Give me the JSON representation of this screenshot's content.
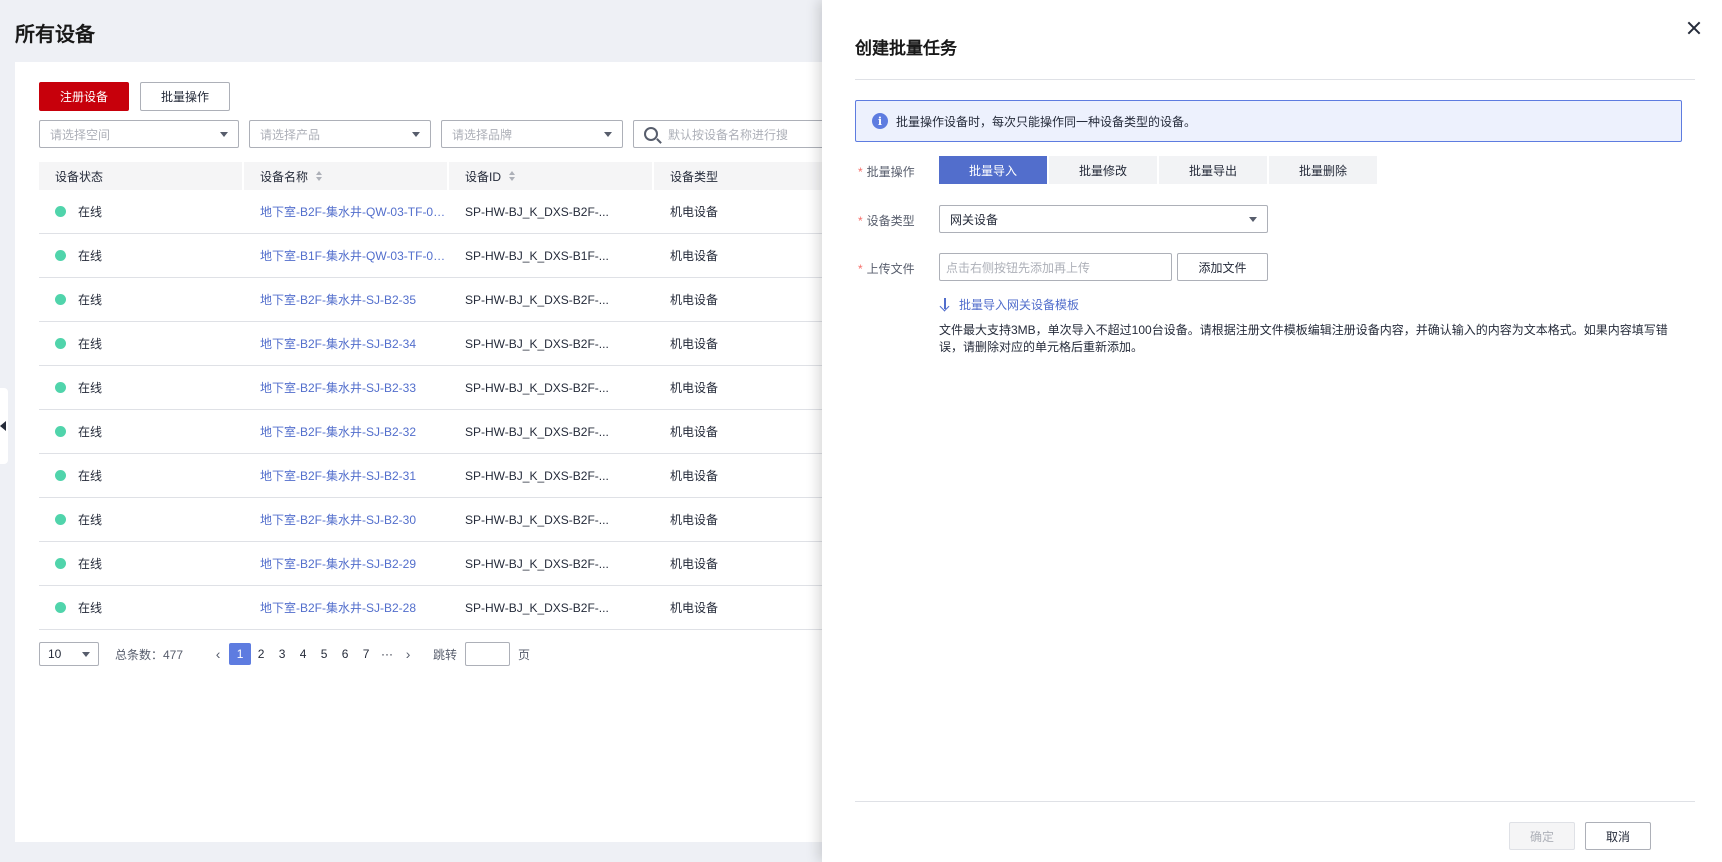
{
  "page": {
    "title": "所有设备"
  },
  "toolbar": {
    "register_label": "注册设备",
    "batch_label": "批量操作"
  },
  "filters": {
    "space_placeholder": "请选择空间",
    "product_placeholder": "请选择产品",
    "brand_placeholder": "请选择品牌",
    "search_placeholder": "默认按设备名称进行搜"
  },
  "table": {
    "headers": [
      "设备状态",
      "设备名称",
      "设备ID",
      "设备类型"
    ],
    "rows": [
      {
        "status": "在线",
        "name": "地下室-B2F-集水井-QW-03-TF-03...",
        "id": "SP-HW-BJ_K_DXS-B2F-...",
        "type": "机电设备"
      },
      {
        "status": "在线",
        "name": "地下室-B1F-集水井-QW-03-TF-04...",
        "id": "SP-HW-BJ_K_DXS-B1F-...",
        "type": "机电设备"
      },
      {
        "status": "在线",
        "name": "地下室-B2F-集水井-SJ-B2-35",
        "id": "SP-HW-BJ_K_DXS-B2F-...",
        "type": "机电设备"
      },
      {
        "status": "在线",
        "name": "地下室-B2F-集水井-SJ-B2-34",
        "id": "SP-HW-BJ_K_DXS-B2F-...",
        "type": "机电设备"
      },
      {
        "status": "在线",
        "name": "地下室-B2F-集水井-SJ-B2-33",
        "id": "SP-HW-BJ_K_DXS-B2F-...",
        "type": "机电设备"
      },
      {
        "status": "在线",
        "name": "地下室-B2F-集水井-SJ-B2-32",
        "id": "SP-HW-BJ_K_DXS-B2F-...",
        "type": "机电设备"
      },
      {
        "status": "在线",
        "name": "地下室-B2F-集水井-SJ-B2-31",
        "id": "SP-HW-BJ_K_DXS-B2F-...",
        "type": "机电设备"
      },
      {
        "status": "在线",
        "name": "地下室-B2F-集水井-SJ-B2-30",
        "id": "SP-HW-BJ_K_DXS-B2F-...",
        "type": "机电设备"
      },
      {
        "status": "在线",
        "name": "地下室-B2F-集水井-SJ-B2-29",
        "id": "SP-HW-BJ_K_DXS-B2F-...",
        "type": "机电设备"
      },
      {
        "status": "在线",
        "name": "地下室-B2F-集水井-SJ-B2-28",
        "id": "SP-HW-BJ_K_DXS-B2F-...",
        "type": "机电设备"
      }
    ]
  },
  "pager": {
    "page_size": "10",
    "total": "总条数：477",
    "pages": [
      "1",
      "2",
      "3",
      "4",
      "5",
      "6",
      "7",
      "···"
    ],
    "current": "1",
    "jump_label": "跳转",
    "page_suffix": "页"
  },
  "drawer": {
    "title": "创建批量任务",
    "notice": "批量操作设备时，每次只能操作同一种设备类型的设备。",
    "op_label": "批量操作",
    "ops": [
      "批量导入",
      "批量修改",
      "批量导出",
      "批量删除"
    ],
    "active_op": "批量导入",
    "type_label": "设备类型",
    "type_value": "网关设备",
    "upload_label": "上传文件",
    "upload_placeholder": "点击右侧按钮先添加再上传",
    "add_file_label": "添加文件",
    "template_link": "批量导入网关设备模板",
    "help_text": "文件最大支持3MB，单次导入不超过100台设备。请根据注册文件模板编辑注册设备内容，并确认输入的内容为文本格式。如果内容填写错误，请删除对应的单元格后重新添加。",
    "confirm_label": "确定",
    "cancel_label": "取消",
    "required_mark": "*"
  },
  "colors": {
    "primary": "#c7000b",
    "accent": "#526ecc",
    "online": "#50d4ab"
  }
}
